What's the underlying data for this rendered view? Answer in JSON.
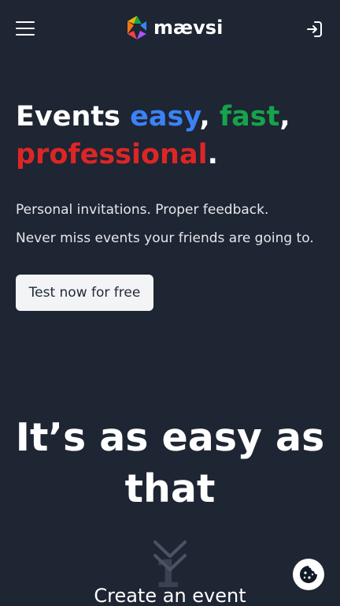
{
  "header": {
    "logo_text": "mævsi",
    "menu_icon": "hamburger-menu-icon",
    "signin_icon": "sign-in-icon"
  },
  "hero": {
    "title_word1": "Events ",
    "title_word2": "easy",
    "title_sep1": ", ",
    "title_word3": "fast",
    "title_sep2": ",",
    "title_word4": "professional",
    "title_end": ".",
    "subtitle_line1": "Personal invitations. Proper feedback.",
    "subtitle_line2": "Never miss events your friends are going to.",
    "cta_label": "Test now for free"
  },
  "steps": {
    "section_title": "It’s as easy as that",
    "step_number": "1",
    "step_title": "Create an event"
  },
  "colors": {
    "background": "#1e2533",
    "easy": "#3b82f6",
    "fast": "#16a34a",
    "professional": "#dc2626",
    "cta_background": "#f3f4f6"
  },
  "cookie": {
    "icon": "cookie-icon"
  }
}
